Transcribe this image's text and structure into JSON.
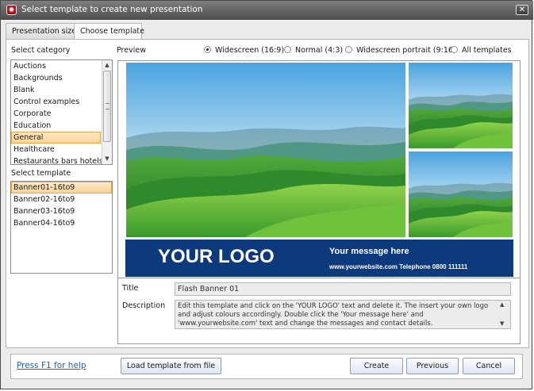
{
  "window": {
    "title": "Select template to create new presentation",
    "close_glyph": "✕"
  },
  "tabs": [
    {
      "label": "Presentation size"
    },
    {
      "label": "Choose template",
      "active": true
    }
  ],
  "category": {
    "label": "Select category",
    "items": [
      "Auctions",
      "Backgrounds",
      "Blank",
      "Control examples",
      "Corporate",
      "Education",
      "General",
      "Healthcare",
      "Restaurants bars hotels"
    ],
    "selected": "General"
  },
  "template": {
    "label": "Select template",
    "items": [
      "Banner01-16to9",
      "Banner02-16to9",
      "Banner03-16to9",
      "Banner04-16to9"
    ],
    "selected": "Banner01-16to9"
  },
  "preview": {
    "label": "Preview",
    "filters": [
      {
        "label": "Widescreen (16:9)",
        "checked": true
      },
      {
        "label": "Normal (4:3)",
        "checked": false
      },
      {
        "label": "Widescreen portrait (9:16)",
        "checked": false
      },
      {
        "label": "All templates",
        "checked": false
      }
    ],
    "banner": {
      "logo": "YOUR LOGO",
      "message": "Your message here",
      "contact": "www.yourwebsite.com  Telephone 0800 111111",
      "color": "#0d3a7d"
    }
  },
  "details": {
    "title_label": "Title",
    "title_value": "Flash Banner 01",
    "description_label": "Description",
    "description_value": "Edit this template and click on the 'YOUR LOGO' text and delete it.  The insert your own logo and adjust colours accordingly.  Double click the 'Your message here' and 'www.yourwebsite.com' text and change the messages and contact details."
  },
  "footer": {
    "help_link": "Press F1 for help",
    "load_button": "Load template from file",
    "create_button": "Create",
    "previous_button": "Previous",
    "cancel_button": "Cancel"
  },
  "colors": {
    "selection_bg": "#fbd497",
    "selection_border": "#e8a64a",
    "titlebar": "#5a5a5a",
    "link": "#1f5fb5"
  },
  "icons": {
    "app": "presentation-app-icon",
    "close": "close-icon",
    "scroll_up": "chevron-up-icon",
    "scroll_down": "chevron-down-icon",
    "radio": "radio-icon"
  }
}
